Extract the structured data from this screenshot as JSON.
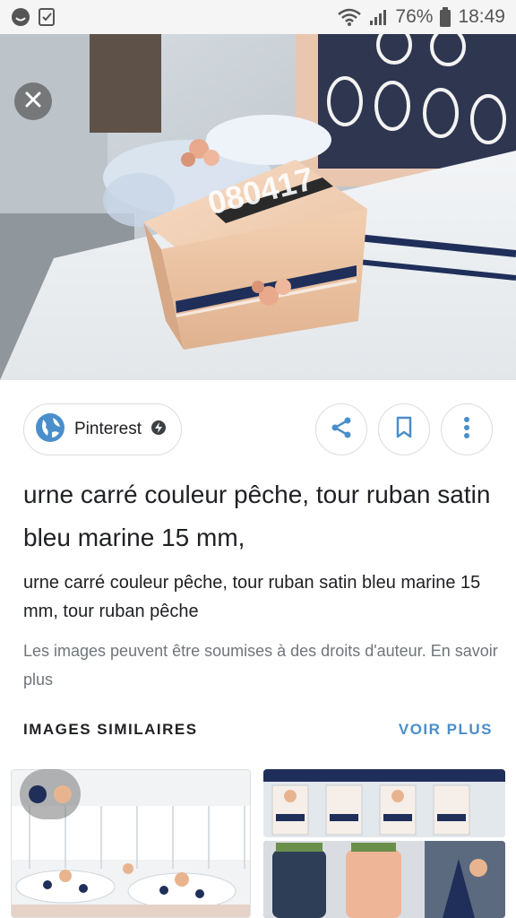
{
  "status_bar": {
    "battery": "76%",
    "time": "18:49"
  },
  "source": {
    "name": "Pinterest"
  },
  "result": {
    "title": "urne carré couleur pêche, tour ruban satin bleu marine 15 mm,",
    "description": "urne carré couleur pêche, tour ruban satin bleu marine 15 mm, tour ruban pêche",
    "copyright": "Les images peuvent être soumises à des droits d'auteur. En savoir plus"
  },
  "similar": {
    "title": "IMAGES SIMILAIRES",
    "more": "VOIR PLUS"
  },
  "colors": {
    "accent_blue": "#4a8ecb",
    "navy": "#1f2f5a",
    "peach": "#e8b48f"
  },
  "icons": {
    "close": "close-icon",
    "share": "share-icon",
    "bookmark": "bookmark-icon",
    "more": "more-vert-icon",
    "globe": "globe-icon"
  }
}
